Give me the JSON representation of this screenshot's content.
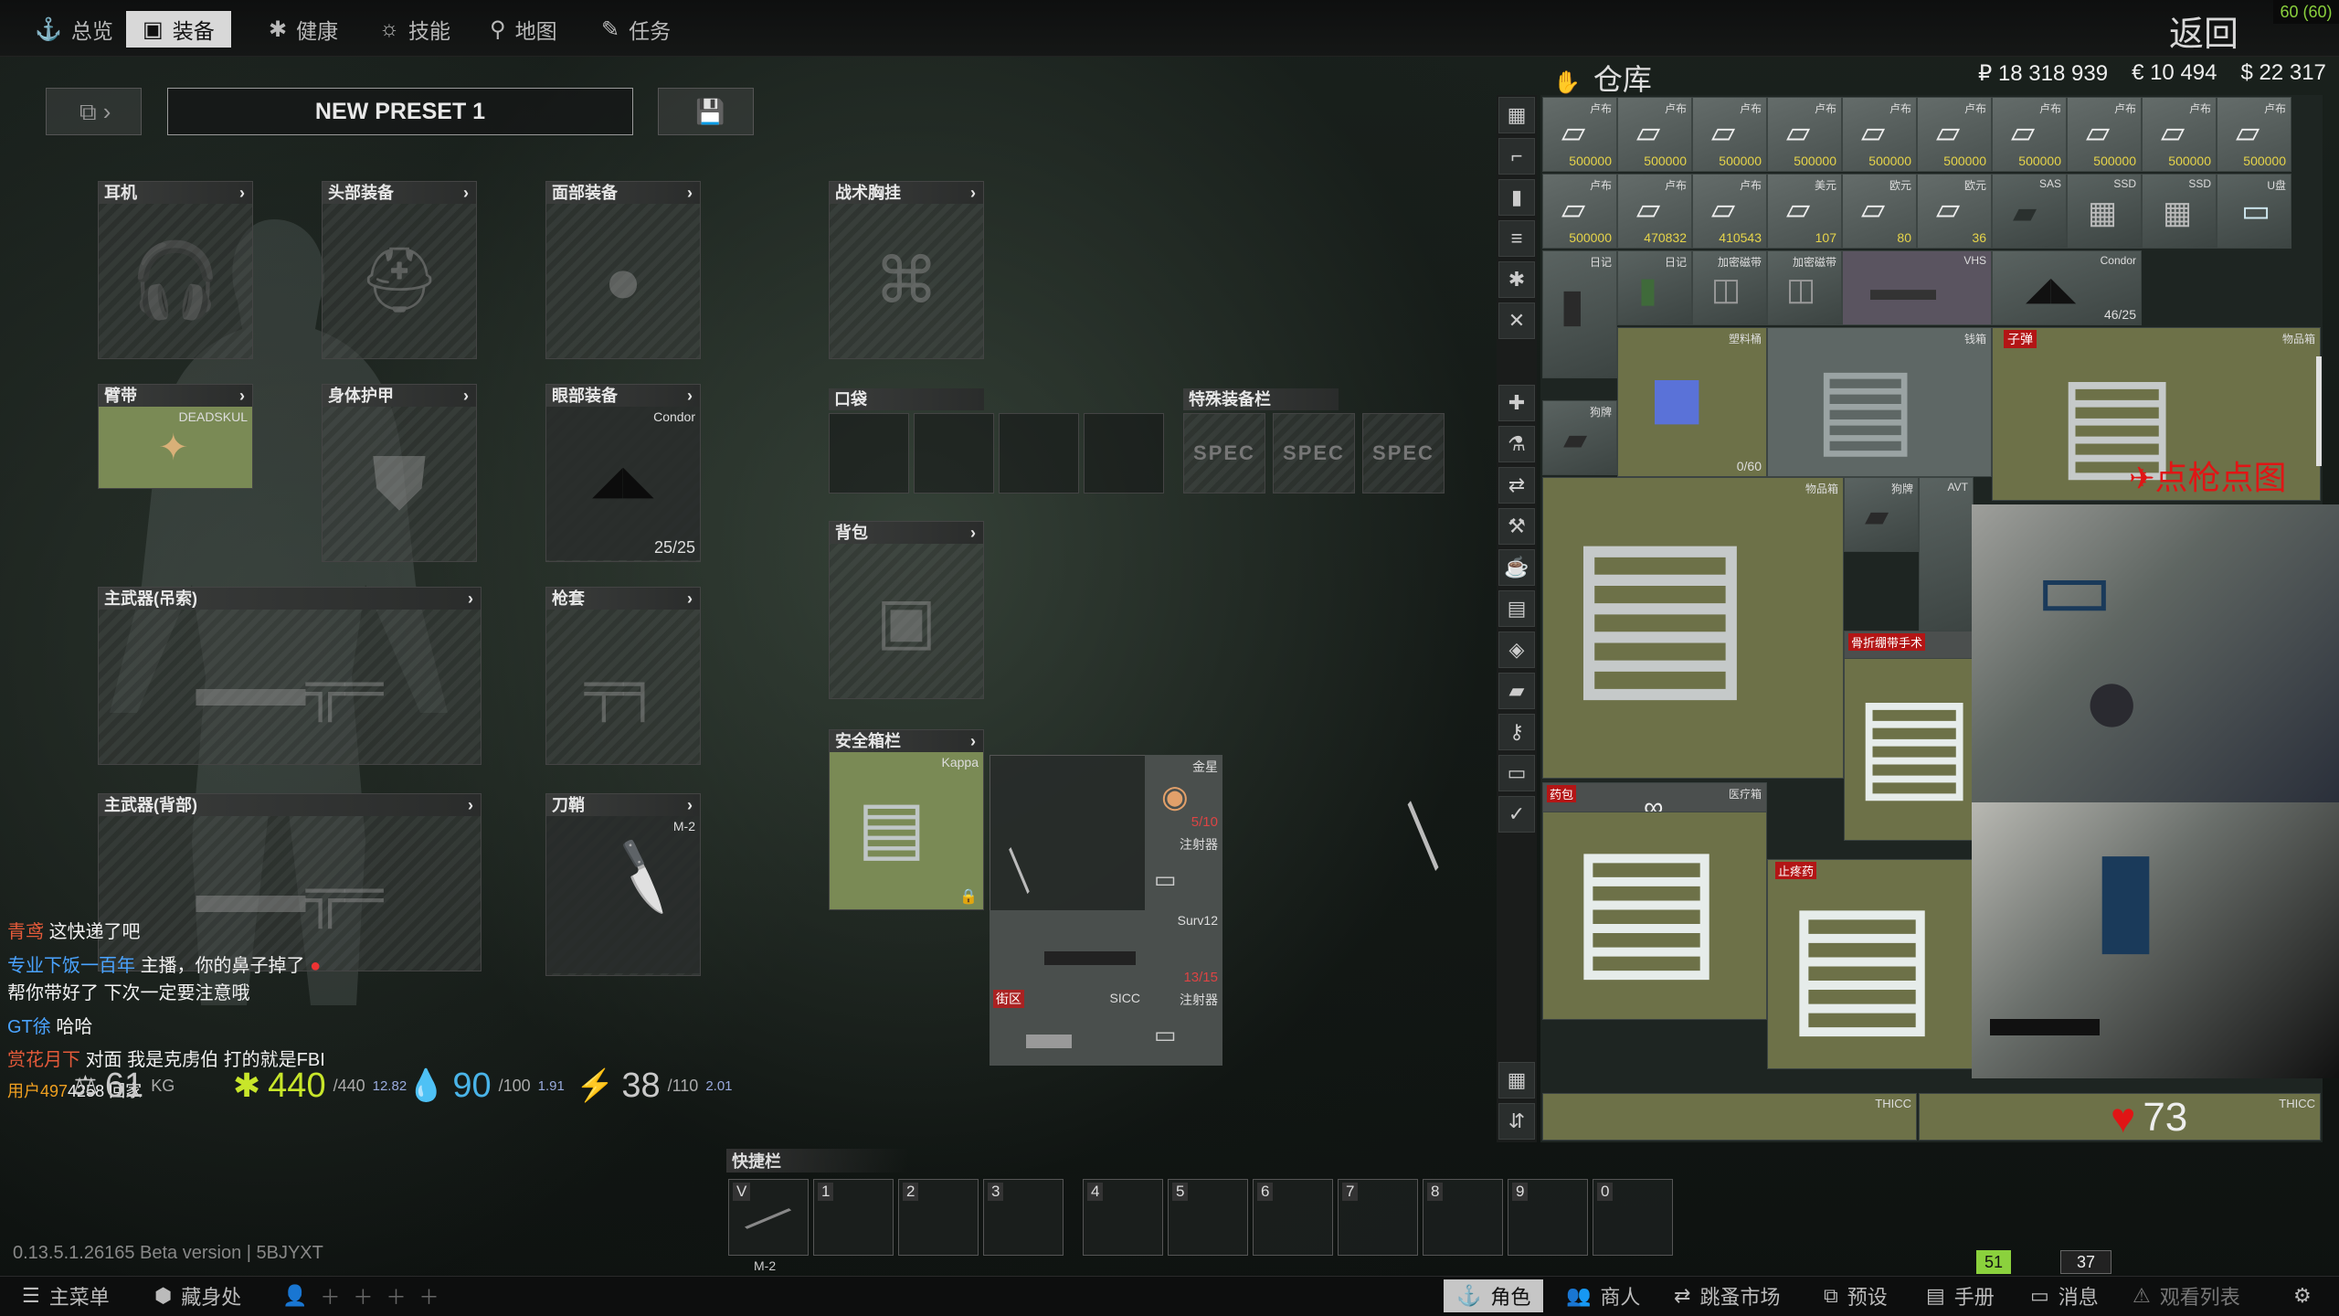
{
  "nav": {
    "tabs": [
      {
        "label": "总览",
        "icon": "anchor-icon"
      },
      {
        "label": "装备",
        "icon": "vest-icon",
        "active": true
      },
      {
        "label": "健康",
        "icon": "health-icon"
      },
      {
        "label": "技能",
        "icon": "skills-icon"
      },
      {
        "label": "地图",
        "icon": "map-pin-icon"
      },
      {
        "label": "任务",
        "icon": "task-icon"
      }
    ],
    "back_label": "返回",
    "fps": "60 (60)"
  },
  "preset": {
    "name": "NEW PRESET 1"
  },
  "slots": {
    "earpiece": "耳机",
    "headwear": "头部装备",
    "facecover": "面部装备",
    "armband": "臂带",
    "body_armor": "身体护甲",
    "eyewear": "眼部装备",
    "primary_sling": "主武器(吊索)",
    "holster": "枪套",
    "primary_back": "主武器(背部)",
    "scabbard": "刀鞘",
    "tactical_rig": "战术胸挂",
    "pockets": "口袋",
    "special": "特殊装备栏",
    "backpack": "背包",
    "secure": "安全箱栏"
  },
  "slot_items": {
    "armband_name": "DEADSKUL",
    "eyewear_name": "Condor",
    "eyewear_dur": "25/25",
    "scabbard_name": "M-2",
    "secure_name": "Kappa",
    "spec_label": "SPEC"
  },
  "secure_contents": [
    {
      "name": "金星",
      "count": "5/10"
    },
    {
      "name": "注射器"
    },
    {
      "name": "Surv12",
      "count": "13/15"
    },
    {
      "name": "街区"
    },
    {
      "name": "SICC"
    },
    {
      "name": "注射器"
    }
  ],
  "chat": [
    {
      "user": "青鸢",
      "text": "这快递了吧",
      "color": "#e45a3a"
    },
    {
      "user": "专业下饭一百年",
      "text": "主播，你的鼻子掉了",
      "color": "#4aa3ff"
    },
    {
      "user": "",
      "text": "帮你带好了 下次一定要注意哦",
      "color": ""
    },
    {
      "user": "GT徐",
      "text": "哈哈",
      "color": "#4aa3ff"
    },
    {
      "user": "赏花月下",
      "text": "对面 我是克虏伯 打的就是FBI",
      "color": "#e45a3a"
    },
    {
      "user": "用户497",
      "text": "4258 回家",
      "color": "#f0a020"
    }
  ],
  "stats": {
    "weight": "61",
    "weight_unit": "KG",
    "energy": "440",
    "energy_max": "/440",
    "energy_chg": "12.82",
    "hydration": "90",
    "hydration_max": "/100",
    "hydration_chg": "1.91",
    "stamina": "38",
    "stamina_max": "/110",
    "stamina_chg": "2.01"
  },
  "quickbar": {
    "title": "快捷栏",
    "slots": [
      "V",
      "1",
      "2",
      "3",
      "4",
      "5",
      "6",
      "7",
      "8",
      "9",
      "0"
    ],
    "v_item": "M-2"
  },
  "version": "0.13.5.1.26165 Beta version | 5BJYXT",
  "stash": {
    "title": "仓库",
    "rub": "₽ 18 318 939",
    "eur": "€ 10 494",
    "usd": "$ 22 317",
    "row1": [
      {
        "label": "卢布",
        "count": "500000"
      },
      {
        "label": "卢布",
        "count": "500000"
      },
      {
        "label": "卢布",
        "count": "500000"
      },
      {
        "label": "卢布",
        "count": "500000"
      },
      {
        "label": "卢布",
        "count": "500000"
      },
      {
        "label": "卢布",
        "count": "500000"
      },
      {
        "label": "卢布",
        "count": "500000"
      },
      {
        "label": "卢布",
        "count": "500000"
      },
      {
        "label": "卢布",
        "count": "500000"
      },
      {
        "label": "卢布",
        "count": "500000"
      }
    ],
    "row2": [
      {
        "label": "卢布",
        "count": "500000"
      },
      {
        "label": "卢布",
        "count": "470832"
      },
      {
        "label": "卢布",
        "count": "410543"
      },
      {
        "label": "美元",
        "count": "107"
      },
      {
        "label": "欧元",
        "count": "80"
      },
      {
        "label": "欧元",
        "count": "36"
      },
      {
        "label": "SAS",
        "count": ""
      },
      {
        "label": "SSD",
        "count": ""
      },
      {
        "label": "SSD",
        "count": ""
      },
      {
        "label": "U盘",
        "count": ""
      }
    ],
    "row3": [
      {
        "label": "日记"
      },
      {
        "label": "日记"
      },
      {
        "label": "加密磁带"
      },
      {
        "label": "加密磁带"
      },
      {
        "label": "VHS"
      },
      {
        "label": "Condor",
        "count": "46/25"
      }
    ],
    "containers": [
      {
        "label": "塑料桶",
        "count": "0/60"
      },
      {
        "label": "钱箱"
      },
      {
        "label": "子弹"
      },
      {
        "label": "物品箱"
      },
      {
        "label": "狗牌"
      },
      {
        "label": "物品箱"
      },
      {
        "label": "狗牌"
      },
      {
        "label": "AVT"
      },
      {
        "label": "骨折绷带手术"
      },
      {
        "label": "药包"
      },
      {
        "label": "医疗箱"
      },
      {
        "label": "止疼药"
      },
      {
        "label": "THICC"
      },
      {
        "label": "THICC"
      }
    ],
    "overlay_text": "点枪点图",
    "heart": "73"
  },
  "bottom": {
    "main_menu": "主菜单",
    "hideout": "藏身处",
    "character": "角色",
    "traders": "商人",
    "flea": "跳蚤市场",
    "presets": "预设",
    "handbook": "手册",
    "messages": "消息",
    "watchlist": "观看列表",
    "level": "51",
    "players": "37"
  },
  "colors": {
    "stash_bg": "#1e2522",
    "accent_green": "#8bd13d",
    "red_label": "#b31515"
  }
}
